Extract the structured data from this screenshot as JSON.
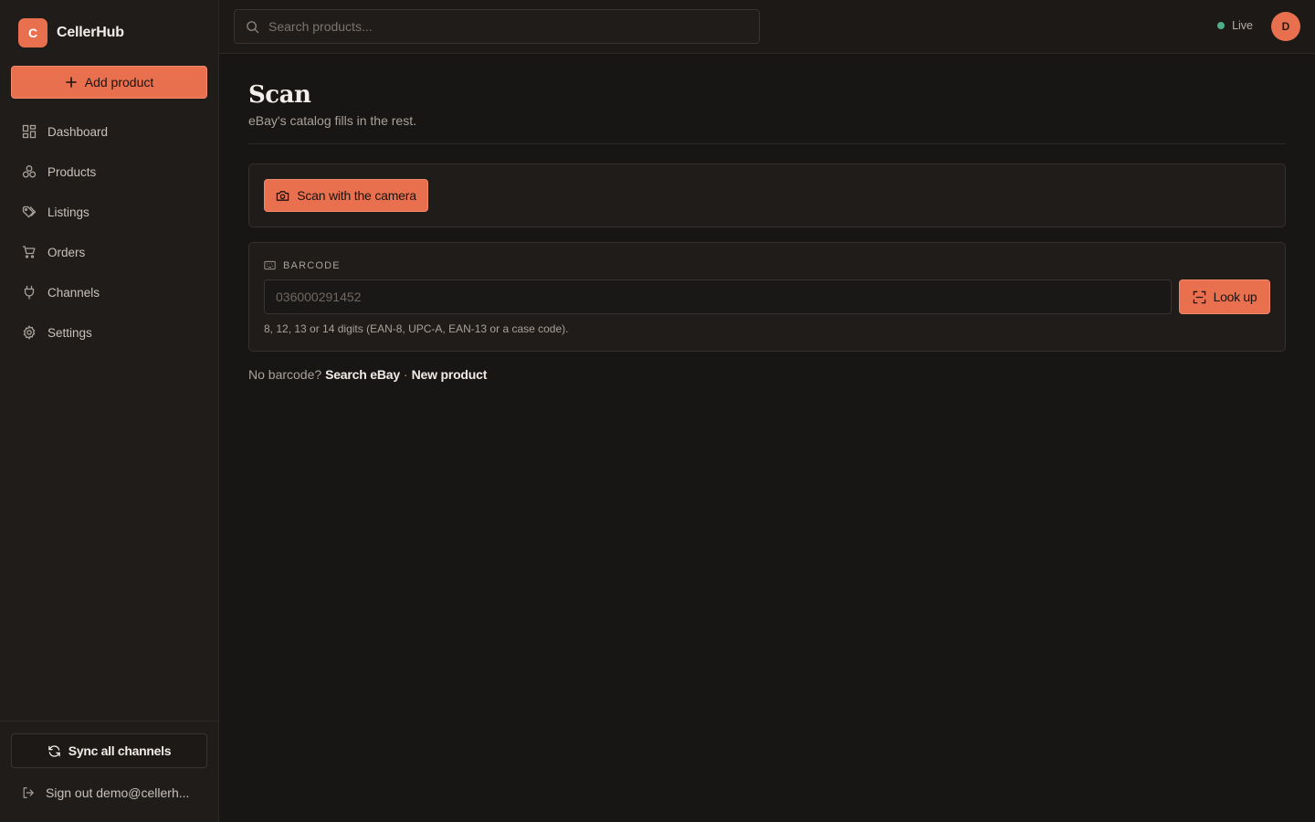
{
  "brand": {
    "logo_letter": "C",
    "name": "CellerHub"
  },
  "sidebar": {
    "add_button": "Add product",
    "items": [
      {
        "label": "Dashboard",
        "icon": "dashboard-icon"
      },
      {
        "label": "Products",
        "icon": "products-icon"
      },
      {
        "label": "Listings",
        "icon": "tag-icon"
      },
      {
        "label": "Orders",
        "icon": "cart-icon"
      },
      {
        "label": "Channels",
        "icon": "plug-icon"
      },
      {
        "label": "Settings",
        "icon": "gear-icon"
      }
    ],
    "sync_button": "Sync all channels",
    "signout": "Sign out demo@cellerh..."
  },
  "topbar": {
    "search_placeholder": "Search products...",
    "status": "Live",
    "avatar_letter": "D"
  },
  "page": {
    "title": "Scan",
    "subtitle": "eBay's catalog fills in the rest."
  },
  "camera": {
    "button": "Scan with the camera"
  },
  "barcode": {
    "label": "BARCODE",
    "placeholder": "036000291452",
    "lookup_button": "Look up",
    "help": "8, 12, 13 or 14 digits (EAN-8, UPC-A, EAN-13 or a case code)."
  },
  "alternatives": {
    "prefix": "No barcode?",
    "search_link": "Search eBay",
    "separator": "·",
    "new_link": "New product"
  },
  "colors": {
    "accent": "#e8704f",
    "background": "#181614",
    "sidebar": "#1f1c1a",
    "live_dot": "#4caf8a"
  }
}
